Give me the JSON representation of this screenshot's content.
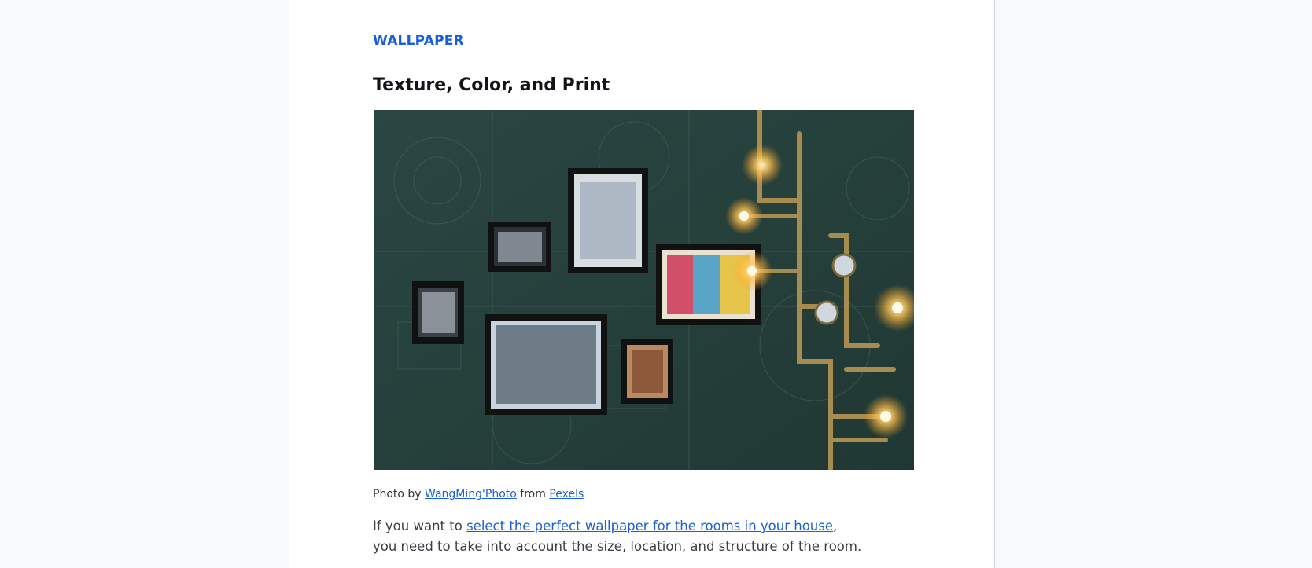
{
  "article": {
    "category": "WALLPAPER",
    "title": "Texture, Color, and Print",
    "photo": {
      "icon": "photo-wall-image",
      "caption_prefix": "Photo by",
      "author": "WangMing'Photo",
      "from_text": "from",
      "source": "Pexels"
    },
    "body": {
      "line1_prefix": "If you want to",
      "line1_link": "select the perfect wallpaper for the rooms in your house",
      "line1_suffix": ",",
      "line2": "you need to take into account the size, location, and structure of the room."
    }
  },
  "colors": {
    "accent": "#1a5fd6",
    "page_bg": "#f8f9fa",
    "wall": "#28433f"
  }
}
